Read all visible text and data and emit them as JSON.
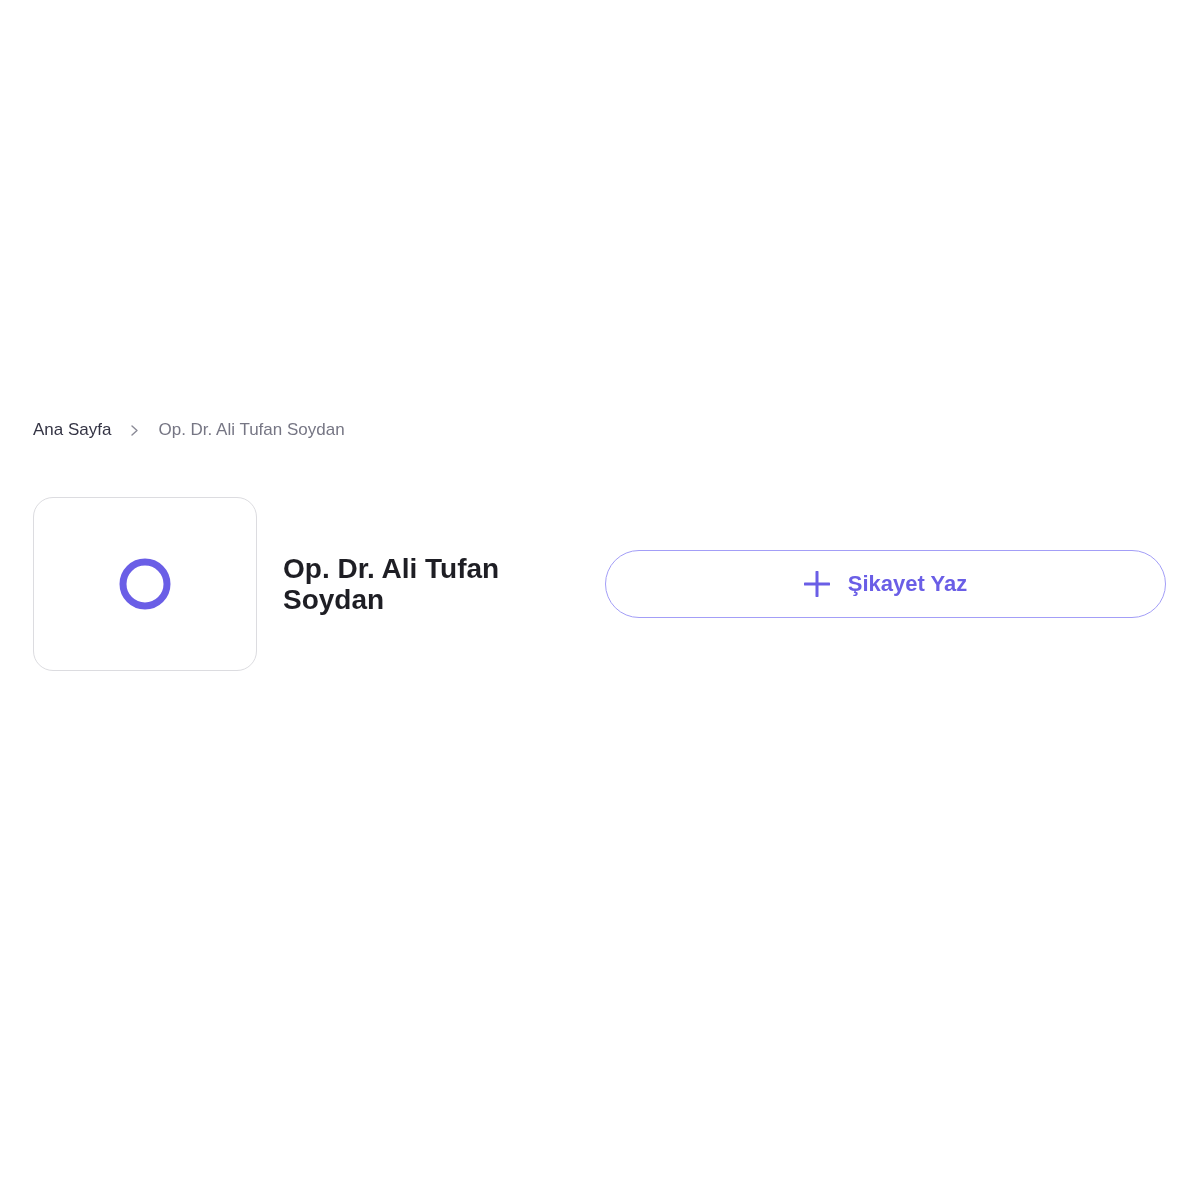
{
  "breadcrumb": [
    {
      "label": "Ana Sayfa",
      "current": false
    },
    {
      "label": "Op. Dr. Ali Tufan Soydan",
      "current": true
    }
  ],
  "profile": {
    "name": "Op. Dr. Ali Tufan Soydan"
  },
  "actions": [
    {
      "label": "Şikayet Yaz",
      "kind": "add"
    }
  ]
}
